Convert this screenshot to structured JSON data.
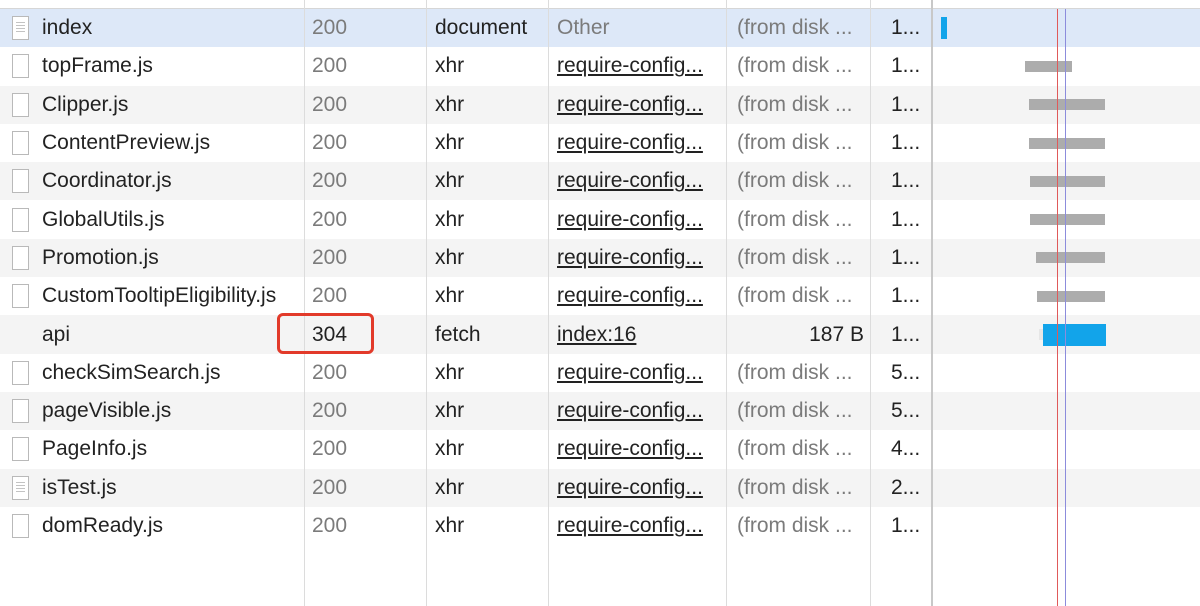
{
  "rows": [
    {
      "name": "index",
      "status": "200",
      "type": "document",
      "initiator": "Other",
      "size": "(from disk ...",
      "time": "1...",
      "icon": "document-icon"
    },
    {
      "name": "topFrame.js",
      "status": "200",
      "type": "xhr",
      "initiator": "require-config...",
      "size": "(from disk ...",
      "time": "1...",
      "icon": "file-icon"
    },
    {
      "name": "Clipper.js",
      "status": "200",
      "type": "xhr",
      "initiator": "require-config...",
      "size": "(from disk ...",
      "time": "1...",
      "icon": "file-icon"
    },
    {
      "name": "ContentPreview.js",
      "status": "200",
      "type": "xhr",
      "initiator": "require-config...",
      "size": "(from disk ...",
      "time": "1...",
      "icon": "file-icon"
    },
    {
      "name": "Coordinator.js",
      "status": "200",
      "type": "xhr",
      "initiator": "require-config...",
      "size": "(from disk ...",
      "time": "1...",
      "icon": "file-icon"
    },
    {
      "name": "GlobalUtils.js",
      "status": "200",
      "type": "xhr",
      "initiator": "require-config...",
      "size": "(from disk ...",
      "time": "1...",
      "icon": "file-icon"
    },
    {
      "name": "Promotion.js",
      "status": "200",
      "type": "xhr",
      "initiator": "require-config...",
      "size": "(from disk ...",
      "time": "1...",
      "icon": "file-icon"
    },
    {
      "name": "CustomTooltipEligibility.js",
      "status": "200",
      "type": "xhr",
      "initiator": "require-config...",
      "size": "(from disk ...",
      "time": "1...",
      "icon": "file-icon"
    },
    {
      "name": "api",
      "status": "304",
      "type": "fetch",
      "initiator": "index:16",
      "size": "187 B",
      "time": "1...",
      "icon": "none"
    },
    {
      "name": "checkSimSearch.js",
      "status": "200",
      "type": "xhr",
      "initiator": "require-config...",
      "size": "(from disk ...",
      "time": "5...",
      "icon": "file-icon"
    },
    {
      "name": "pageVisible.js",
      "status": "200",
      "type": "xhr",
      "initiator": "require-config...",
      "size": "(from disk ...",
      "time": "5...",
      "icon": "file-icon"
    },
    {
      "name": "PageInfo.js",
      "status": "200",
      "type": "xhr",
      "initiator": "require-config...",
      "size": "(from disk ...",
      "time": "4...",
      "icon": "file-icon"
    },
    {
      "name": "isTest.js",
      "status": "200",
      "type": "xhr",
      "initiator": "require-config...",
      "size": "(from disk ...",
      "time": "2...",
      "icon": "document-icon"
    },
    {
      "name": "domReady.js",
      "status": "200",
      "type": "xhr",
      "initiator": "require-config...",
      "size": "(from disk ...",
      "time": "1...",
      "icon": "file-icon"
    }
  ],
  "colors": {
    "selected_row": "#dde8f8",
    "alt_row": "#f4f4f4",
    "highlight_border": "#e23a2a",
    "waterfall_bar": "#acacac",
    "waterfall_bar_active": "#12a4ea",
    "dom_content_loaded_line": "#8c8cdc",
    "load_line": "#e05a5a"
  }
}
